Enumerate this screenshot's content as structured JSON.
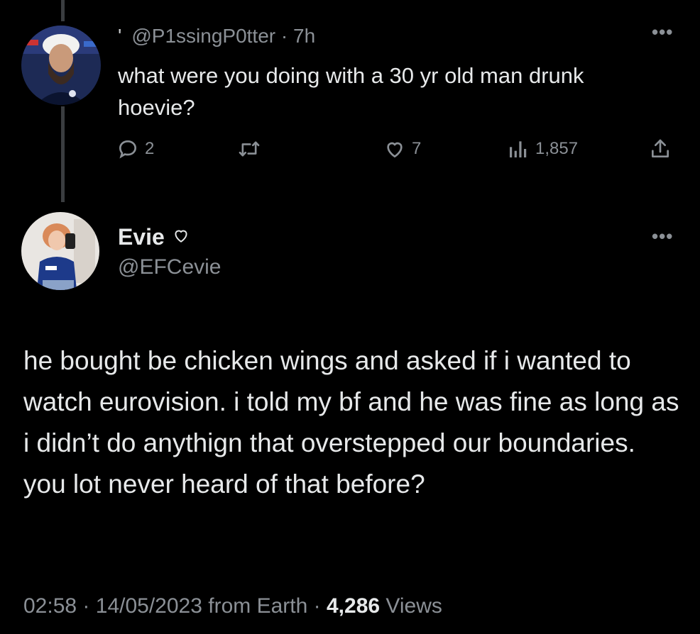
{
  "reply": {
    "handle": "@P1ssingP0tter",
    "separator": "·",
    "time": "7h",
    "text": "what were you doing with a 30 yr old man drunk hoevie?",
    "replies": "2",
    "likes": "7",
    "views": "1,857",
    "icons": [
      "more-icon",
      "reply-icon",
      "retweet-icon",
      "like-icon",
      "views-icon",
      "share-icon"
    ]
  },
  "tweet": {
    "name": "Evie",
    "name_emoji": "white-heart-icon",
    "handle": "@EFCevie",
    "text": "he bought be chicken wings and asked if i wanted to watch eurovision. i told my bf and he was fine as long as i didn’t do anythign that overstepped our boundaries. you lot never heard of that before?",
    "time": "02:58",
    "date": "14/05/2023",
    "source": "from Earth",
    "separator": "·",
    "views_count": "4,286",
    "views_label": "Views"
  },
  "colors": {
    "background": "#000000",
    "text_primary": "#e7e9ea",
    "text_secondary": "#8b9096",
    "thread_line": "#3a3d40"
  }
}
